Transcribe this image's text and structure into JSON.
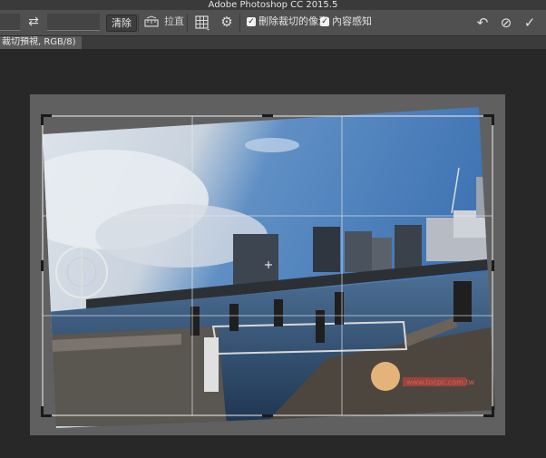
{
  "app": {
    "title": "Adobe Photoshop CC 2015.5"
  },
  "options": {
    "clear_label": "清除",
    "straighten_label": "拉直",
    "delete_cropped_label": "刪除裁切的像素",
    "content_aware_label": "內容感知",
    "delete_cropped_checked": true,
    "content_aware_checked": true
  },
  "document": {
    "tab_label": "裁切預視, RGB/8)"
  },
  "icons": {
    "swap": "swap-arrows-icon",
    "straighten": "level-ruler-icon",
    "overlay": "grid-overlay-icon",
    "settings": "gear-icon",
    "reset": "undo-icon",
    "cancel": "cancel-icon",
    "commit": "check-icon"
  },
  "watermark": {
    "text": "www.tocpc.com.tw"
  }
}
